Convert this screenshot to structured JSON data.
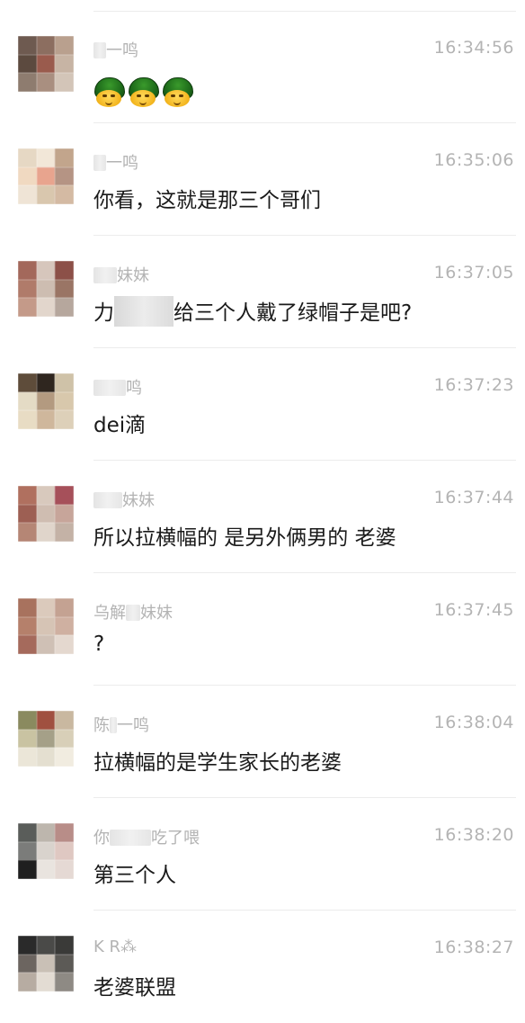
{
  "messages": [
    {
      "name": "一鸣",
      "time": "16:34:56",
      "text": "",
      "emoji": [
        "green-hat-turtle",
        "green-hat-turtle",
        "green-hat-turtle"
      ],
      "avatar": [
        "#6e5a50",
        "#8c6e60",
        "#b9a08e",
        "#5c4a3f",
        "#9a5b4d",
        "#c7b4a4",
        "#8e7c6f",
        "#a98f80",
        "#d3c5b8"
      ]
    },
    {
      "name": "一鸣",
      "time": "16:35:06",
      "text": "你看，这就是那三个哥们",
      "avatar": [
        "#e6d8c4",
        "#f2e7d8",
        "#c2a58c",
        "#f0d9c1",
        "#e8a48e",
        "#b59484",
        "#efe4d6",
        "#d9c7ae",
        "#d4baa3"
      ]
    },
    {
      "name": "妹妹",
      "time": "16:37:05",
      "text_before": "力",
      "text": "给三个人戴了绿帽子是吧?",
      "avatar": [
        "#a3685b",
        "#d6c6bc",
        "#8c5048",
        "#b07b6a",
        "#cdbdb1",
        "#9a7565",
        "#c49a89",
        "#e2d6cc",
        "#b6a79d"
      ]
    },
    {
      "name": "鸣",
      "time": "16:37:23",
      "text": "dei滴",
      "avatar": [
        "#5e4c3a",
        "#2f261f",
        "#cfc2a8",
        "#e4dbc5",
        "#b39a80",
        "#d8c8ac",
        "#e8dcc4",
        "#cfb79c",
        "#ddd0b9"
      ]
    },
    {
      "name": "妹妹",
      "time": "16:37:44",
      "text": "所以拉横幅的 是另外俩男的 老婆",
      "avatar": [
        "#b0705f",
        "#d8c9bd",
        "#a6505a",
        "#9d5f53",
        "#cfbdb1",
        "#c7a59a",
        "#b58675",
        "#e0d5cb",
        "#c4b2a6"
      ]
    },
    {
      "name": "妹妹",
      "name_prefix": "乌解",
      "time": "16:37:45",
      "text": "?",
      "avatar": [
        "#a8725e",
        "#dbcabc",
        "#c4a292",
        "#b5806b",
        "#d6c4b5",
        "#cfb0a1",
        "#a56a5c",
        "#cfc0b5",
        "#e4d8cf"
      ]
    },
    {
      "name": "一鸣",
      "name_prefix": "陈",
      "time": "16:38:04",
      "text": "拉横幅的是学生家长的老婆",
      "avatar": [
        "#8a8a5f",
        "#a05040",
        "#c9b8a0",
        "#c9c3a2",
        "#a5a088",
        "#d8cfb8",
        "#ebe6d8",
        "#e4dfd0",
        "#f1ece0"
      ]
    },
    {
      "name": "吃了喂",
      "name_prefix": "你",
      "time": "16:38:20",
      "text": "第三个人",
      "avatar": [
        "#5a5d5a",
        "#bdb6ad",
        "#b88d88",
        "#7b7c7a",
        "#d9d3cd",
        "#dfc8c2",
        "#1f1f1f",
        "#e9e4df",
        "#e5d9d4"
      ]
    },
    {
      "name": "K R⁂",
      "time": "16:38:27",
      "text": "老婆联盟",
      "avatar": [
        "#2a2a2a",
        "#4a4a48",
        "#3a3a38",
        "#6c6560",
        "#c9c0b6",
        "#5c5a56",
        "#b7aca2",
        "#e3dcd3",
        "#8e8a84"
      ]
    }
  ]
}
